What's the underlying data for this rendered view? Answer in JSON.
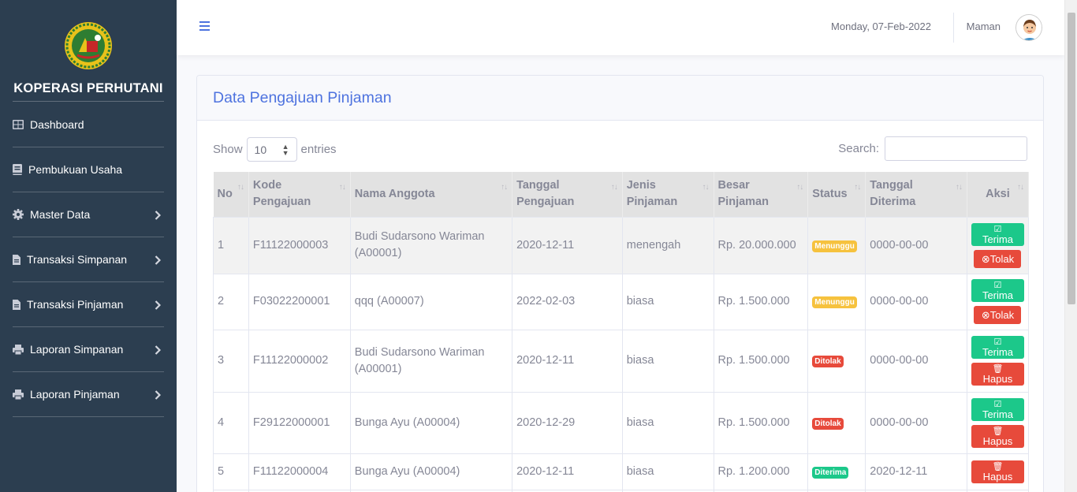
{
  "brand": {
    "title": "KOPERASI PERHUTANI"
  },
  "sidebar": {
    "items": [
      {
        "label": "Dashboard",
        "icon": "table-icon",
        "has_chevron": false
      },
      {
        "label": "Pembukuan Usaha",
        "icon": "book-icon",
        "has_chevron": false
      },
      {
        "label": "Master Data",
        "icon": "gear-icon",
        "has_chevron": true
      },
      {
        "label": "Transaksi Simpanan",
        "icon": "file-icon",
        "has_chevron": true
      },
      {
        "label": "Transaksi Pinjaman",
        "icon": "file-icon",
        "has_chevron": true
      },
      {
        "label": "Laporan Simpanan",
        "icon": "printer-icon",
        "has_chevron": true
      },
      {
        "label": "Laporan Pinjaman",
        "icon": "printer-icon",
        "has_chevron": true
      }
    ]
  },
  "topbar": {
    "date": "Monday, 07-Feb-2022",
    "user": "Maman"
  },
  "page": {
    "title": "Data Pengajuan Pinjaman"
  },
  "table_controls": {
    "show_label": "Show",
    "entries_value": "10",
    "entries_label": "entries",
    "search_label": "Search:",
    "search_value": ""
  },
  "table": {
    "headers": [
      "No",
      "Kode Pengajuan",
      "Nama Anggota",
      "Tanggal Pengajuan",
      "Jenis Pinjaman",
      "Besar Pinjaman",
      "Status",
      "Tanggal Diterima",
      "Aksi"
    ],
    "header_lines": [
      [
        "No"
      ],
      [
        "Kode",
        "Pengajuan"
      ],
      [
        "Nama Anggota"
      ],
      [
        "Tanggal",
        "Pengajuan"
      ],
      [
        "Jenis",
        "Pinjaman"
      ],
      [
        "Besar",
        "Pinjaman"
      ],
      [
        "Status"
      ],
      [
        "Tanggal",
        "Diterima"
      ],
      [
        "Aksi"
      ]
    ],
    "rows": [
      {
        "no": "1",
        "kode": "F11122000003",
        "nama": "Budi Sudarsono Wariman (A00001)",
        "tanggal": "2020-12-11",
        "jenis": "menengah",
        "besar": "Rp. 20.000.000",
        "status": "Menunggu",
        "status_type": "wait",
        "diterima": "0000-00-00",
        "actions": [
          "Terima",
          "Tolak"
        ]
      },
      {
        "no": "2",
        "kode": "F03022200001",
        "nama": "qqq (A00007)",
        "tanggal": "2022-02-03",
        "jenis": "biasa",
        "besar": "Rp. 1.500.000",
        "status": "Menunggu",
        "status_type": "wait",
        "diterima": "0000-00-00",
        "actions": [
          "Terima",
          "Tolak"
        ]
      },
      {
        "no": "3",
        "kode": "F11122000002",
        "nama": "Budi Sudarsono Wariman (A00001)",
        "tanggal": "2020-12-11",
        "jenis": "biasa",
        "besar": "Rp. 1.500.000",
        "status": "Ditolak",
        "status_type": "reject",
        "diterima": "0000-00-00",
        "actions": [
          "Terima",
          "Hapus"
        ]
      },
      {
        "no": "4",
        "kode": "F29122000001",
        "nama": "Bunga Ayu (A00004)",
        "tanggal": "2020-12-29",
        "jenis": "biasa",
        "besar": "Rp. 1.500.000",
        "status": "Ditolak",
        "status_type": "reject",
        "diterima": "0000-00-00",
        "actions": [
          "Terima",
          "Hapus"
        ]
      },
      {
        "no": "5",
        "kode": "F11122000004",
        "nama": "Bunga Ayu (A00004)",
        "tanggal": "2020-12-11",
        "jenis": "biasa",
        "besar": "Rp. 1.200.000",
        "status": "Diterima",
        "status_type": "accept",
        "diterima": "2020-12-11",
        "actions": [
          "Hapus"
        ]
      }
    ]
  },
  "colors": {
    "sidebar_bg": "#2c3e50",
    "primary": "#4e73df",
    "success": "#1cc88a",
    "danger": "#e74a3b",
    "warning": "#f6c23e"
  }
}
